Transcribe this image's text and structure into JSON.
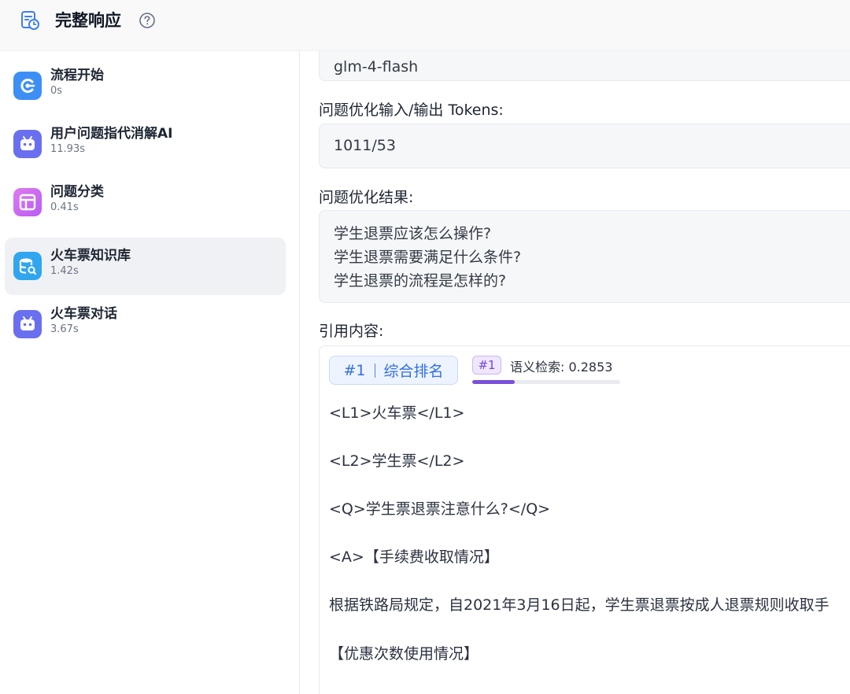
{
  "header": {
    "title": "完整响应"
  },
  "steps": [
    {
      "name": "流程开始",
      "time": "0s",
      "icon": "start-icon",
      "color": "#3d8ff5"
    },
    {
      "name": "用户问题指代消解AI",
      "time": "11.93s",
      "icon": "robot-icon",
      "color": "#6a6ff0"
    },
    {
      "name": "问题分类",
      "time": "0.41s",
      "icon": "layout-icon",
      "color": "#d56ef3"
    },
    {
      "name": "火车票知识库",
      "time": "1.42s",
      "icon": "database-search-icon",
      "color": "#2fa6ef",
      "active": true
    },
    {
      "name": "火车票对话",
      "time": "3.67s",
      "icon": "robot-icon",
      "color": "#6a6ff0"
    }
  ],
  "main": {
    "model_value": "glm-4-flash",
    "tokens_label": "问题优化输入/输出 Tokens:",
    "tokens_value": "1011/53",
    "opt_label": "问题优化结果:",
    "opt_lines": [
      "学生退票应该怎么操作?",
      "学生退票需要满足什么条件?",
      "学生退票的流程是怎样的?"
    ],
    "quote_label": "引用内容:",
    "quote": {
      "rank_num": "#1",
      "rank_text": "综合排名",
      "sem_badge": "#1",
      "sem_text": "语义检索: 0.2853",
      "sem_score": 0.2853,
      "lines": [
        "<L1>火车票</L1>",
        "<L2>学生票</L2>",
        "<Q>学生票退票注意什么?</Q>",
        "<A>【手续费收取情况】",
        "根据铁路局规定，自2021年3月16日起，学生票退票按成人退票规则收取手",
        "【优惠次数使用情况】"
      ]
    }
  }
}
